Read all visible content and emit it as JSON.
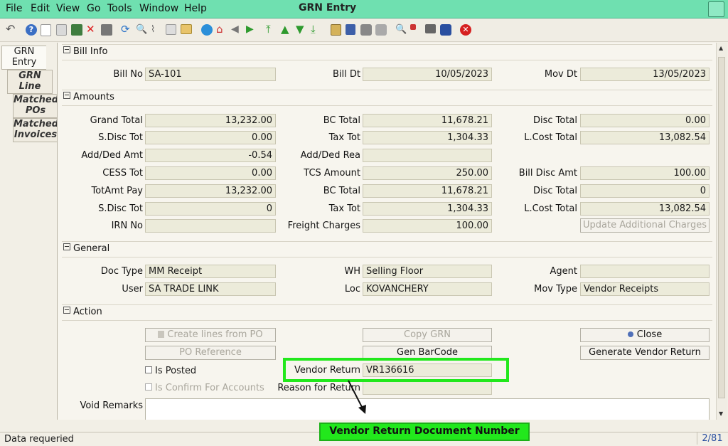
{
  "menu": {
    "items": [
      {
        "label": "File"
      },
      {
        "label": "Edit"
      },
      {
        "label": "View"
      },
      {
        "label": "Go"
      },
      {
        "label": "Tools"
      },
      {
        "label": "Window"
      },
      {
        "label": "Help"
      }
    ],
    "window_title": "GRN Entry"
  },
  "tabs": {
    "grn_entry": "GRN\nEntry",
    "grn_line": "GRN\nLine",
    "matched_pos": "Matched\nPOs",
    "matched_invoices": "Matched\nInvoices"
  },
  "bill_info": {
    "section": "Bill Info",
    "bill_no_label": "Bill No",
    "bill_no": "SA-101",
    "bill_dt_label": "Bill Dt",
    "bill_dt": "10/05/2023",
    "mov_dt_label": "Mov Dt",
    "mov_dt": "13/05/2023"
  },
  "amounts": {
    "section": "Amounts",
    "grand_total_label": "Grand Total",
    "grand_total": "13,232.00",
    "bc_total_label": "BC Total",
    "bc_total": "11,678.21",
    "disc_total_label": "Disc Total",
    "disc_total": "0.00",
    "s_disc_tot_label": "S.Disc Tot",
    "s_disc_tot": "0.00",
    "tax_tot_label": "Tax Tot",
    "tax_tot": "1,304.33",
    "l_cost_total_label": "L.Cost Total",
    "l_cost_total": "13,082.54",
    "add_ded_amt_label": "Add/Ded Amt",
    "add_ded_amt": "-0.54",
    "add_ded_rea_label": "Add/Ded Rea",
    "add_ded_rea": "",
    "cess_tot_label": "CESS Tot",
    "cess_tot": "0.00",
    "tcs_amount_label": "TCS Amount",
    "tcs_amount": "250.00",
    "bill_disc_amt_label": "Bill Disc Amt",
    "bill_disc_amt": "100.00",
    "totamt_pay_label": "TotAmt Pay",
    "totamt_pay": "13,232.00",
    "bc_total2_label": "BC Total",
    "bc_total2": "11,678.21",
    "disc_total2_label": "Disc Total",
    "disc_total2": "0",
    "s_disc_tot2_label": "S.Disc Tot",
    "s_disc_tot2": "0",
    "tax_tot2_label": "Tax Tot",
    "tax_tot2": "1,304.33",
    "l_cost_total2_label": "L.Cost Total",
    "l_cost_total2": "13,082.54",
    "irn_no_label": "IRN No",
    "irn_no": "",
    "freight_label": "Freight Charges",
    "freight": "100.00",
    "update_charges_btn": "Update Additional Charges"
  },
  "general": {
    "section": "General",
    "doc_type_label": "Doc Type",
    "doc_type": "MM Receipt",
    "wh_label": "WH",
    "wh": "Selling Floor",
    "agent_label": "Agent",
    "agent": "",
    "user_label": "User",
    "user": "SA TRADE LINK",
    "loc_label": "Loc",
    "loc": "KOVANCHERY",
    "mov_type_label": "Mov Type",
    "mov_type": "Vendor Receipts"
  },
  "action": {
    "section": "Action",
    "create_lines_btn": "Create lines from PO",
    "copy_grn_btn": "Copy GRN",
    "close_btn": "Close",
    "po_reference_btn": "PO Reference",
    "gen_barcode_btn": "Gen BarCode",
    "gen_vendor_return_btn": "Generate Vendor Return",
    "is_posted_label": "Is Posted",
    "vendor_return_label": "Vendor Return",
    "vendor_return": "VR136616",
    "is_confirm_label": "Is Confirm For Accounts",
    "reason_label": "Reason for Return",
    "reason": "",
    "void_remarks_label": "Void Remarks",
    "void_remarks": ""
  },
  "status": {
    "message": "Data requeried",
    "record": "2/81"
  },
  "annotation": {
    "callout": "Vendor Return Document Number",
    "color": "#22e81c"
  }
}
